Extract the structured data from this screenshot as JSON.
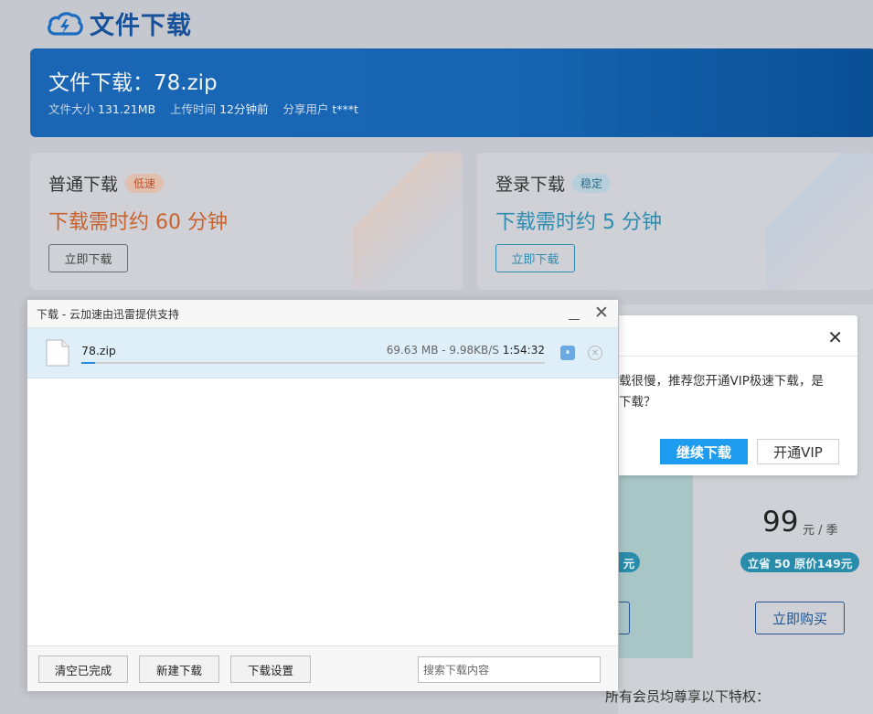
{
  "site": {
    "logo_text": "文件下载"
  },
  "banner": {
    "title": "文件下载：78.zip",
    "size_label": "文件大小",
    "size_value": "131.21MB",
    "upload_label": "上传时间",
    "upload_value": "12分钟前",
    "sharer_label": "分享用户",
    "sharer_value": "t***t"
  },
  "cards": {
    "normal": {
      "title": "普通下载",
      "badge": "低速",
      "time": "下载需时约 60 分钟",
      "button": "立即下载"
    },
    "login": {
      "title": "登录下载",
      "badge": "稳定",
      "time": "下载需时约 5 分钟",
      "button": "立即下载"
    }
  },
  "vip": {
    "price": "99",
    "unit": "元 / 季",
    "save_badge": "立省 50 原价149元",
    "save_badge_left": "元",
    "buy_button": "立即购买",
    "perks_title": "所有会员均尊享以下特权："
  },
  "vip_dialog": {
    "message_line1": "载很慢，推荐您开通VIP极速下载，是",
    "message_line2": "下载？",
    "continue_button": "继续下载",
    "vip_button": "开通VIP",
    "close_glyph": "✕"
  },
  "download_manager": {
    "title": "下载 - 云加速由迅雷提供支持",
    "minimize_glyph": "",
    "close_glyph": "✕",
    "task": {
      "filename": "78.zip",
      "size": "69.63 MB",
      "speed": "9.98KB/S",
      "separator": " - ",
      "remaining": "1:54:32",
      "progress_fraction": 0.03,
      "pause_glyph": "⏸",
      "cancel_glyph": "✕"
    },
    "footer": {
      "clear_button": "清空已完成",
      "new_button": "新建下载",
      "settings_button": "下载设置",
      "search_placeholder": "搜索下载内容"
    }
  },
  "colors": {
    "accent_blue": "#1e9cf0",
    "progress": "#2a8ce0",
    "slow_orange": "#c8622e",
    "stable_teal": "#2f8bb0"
  }
}
